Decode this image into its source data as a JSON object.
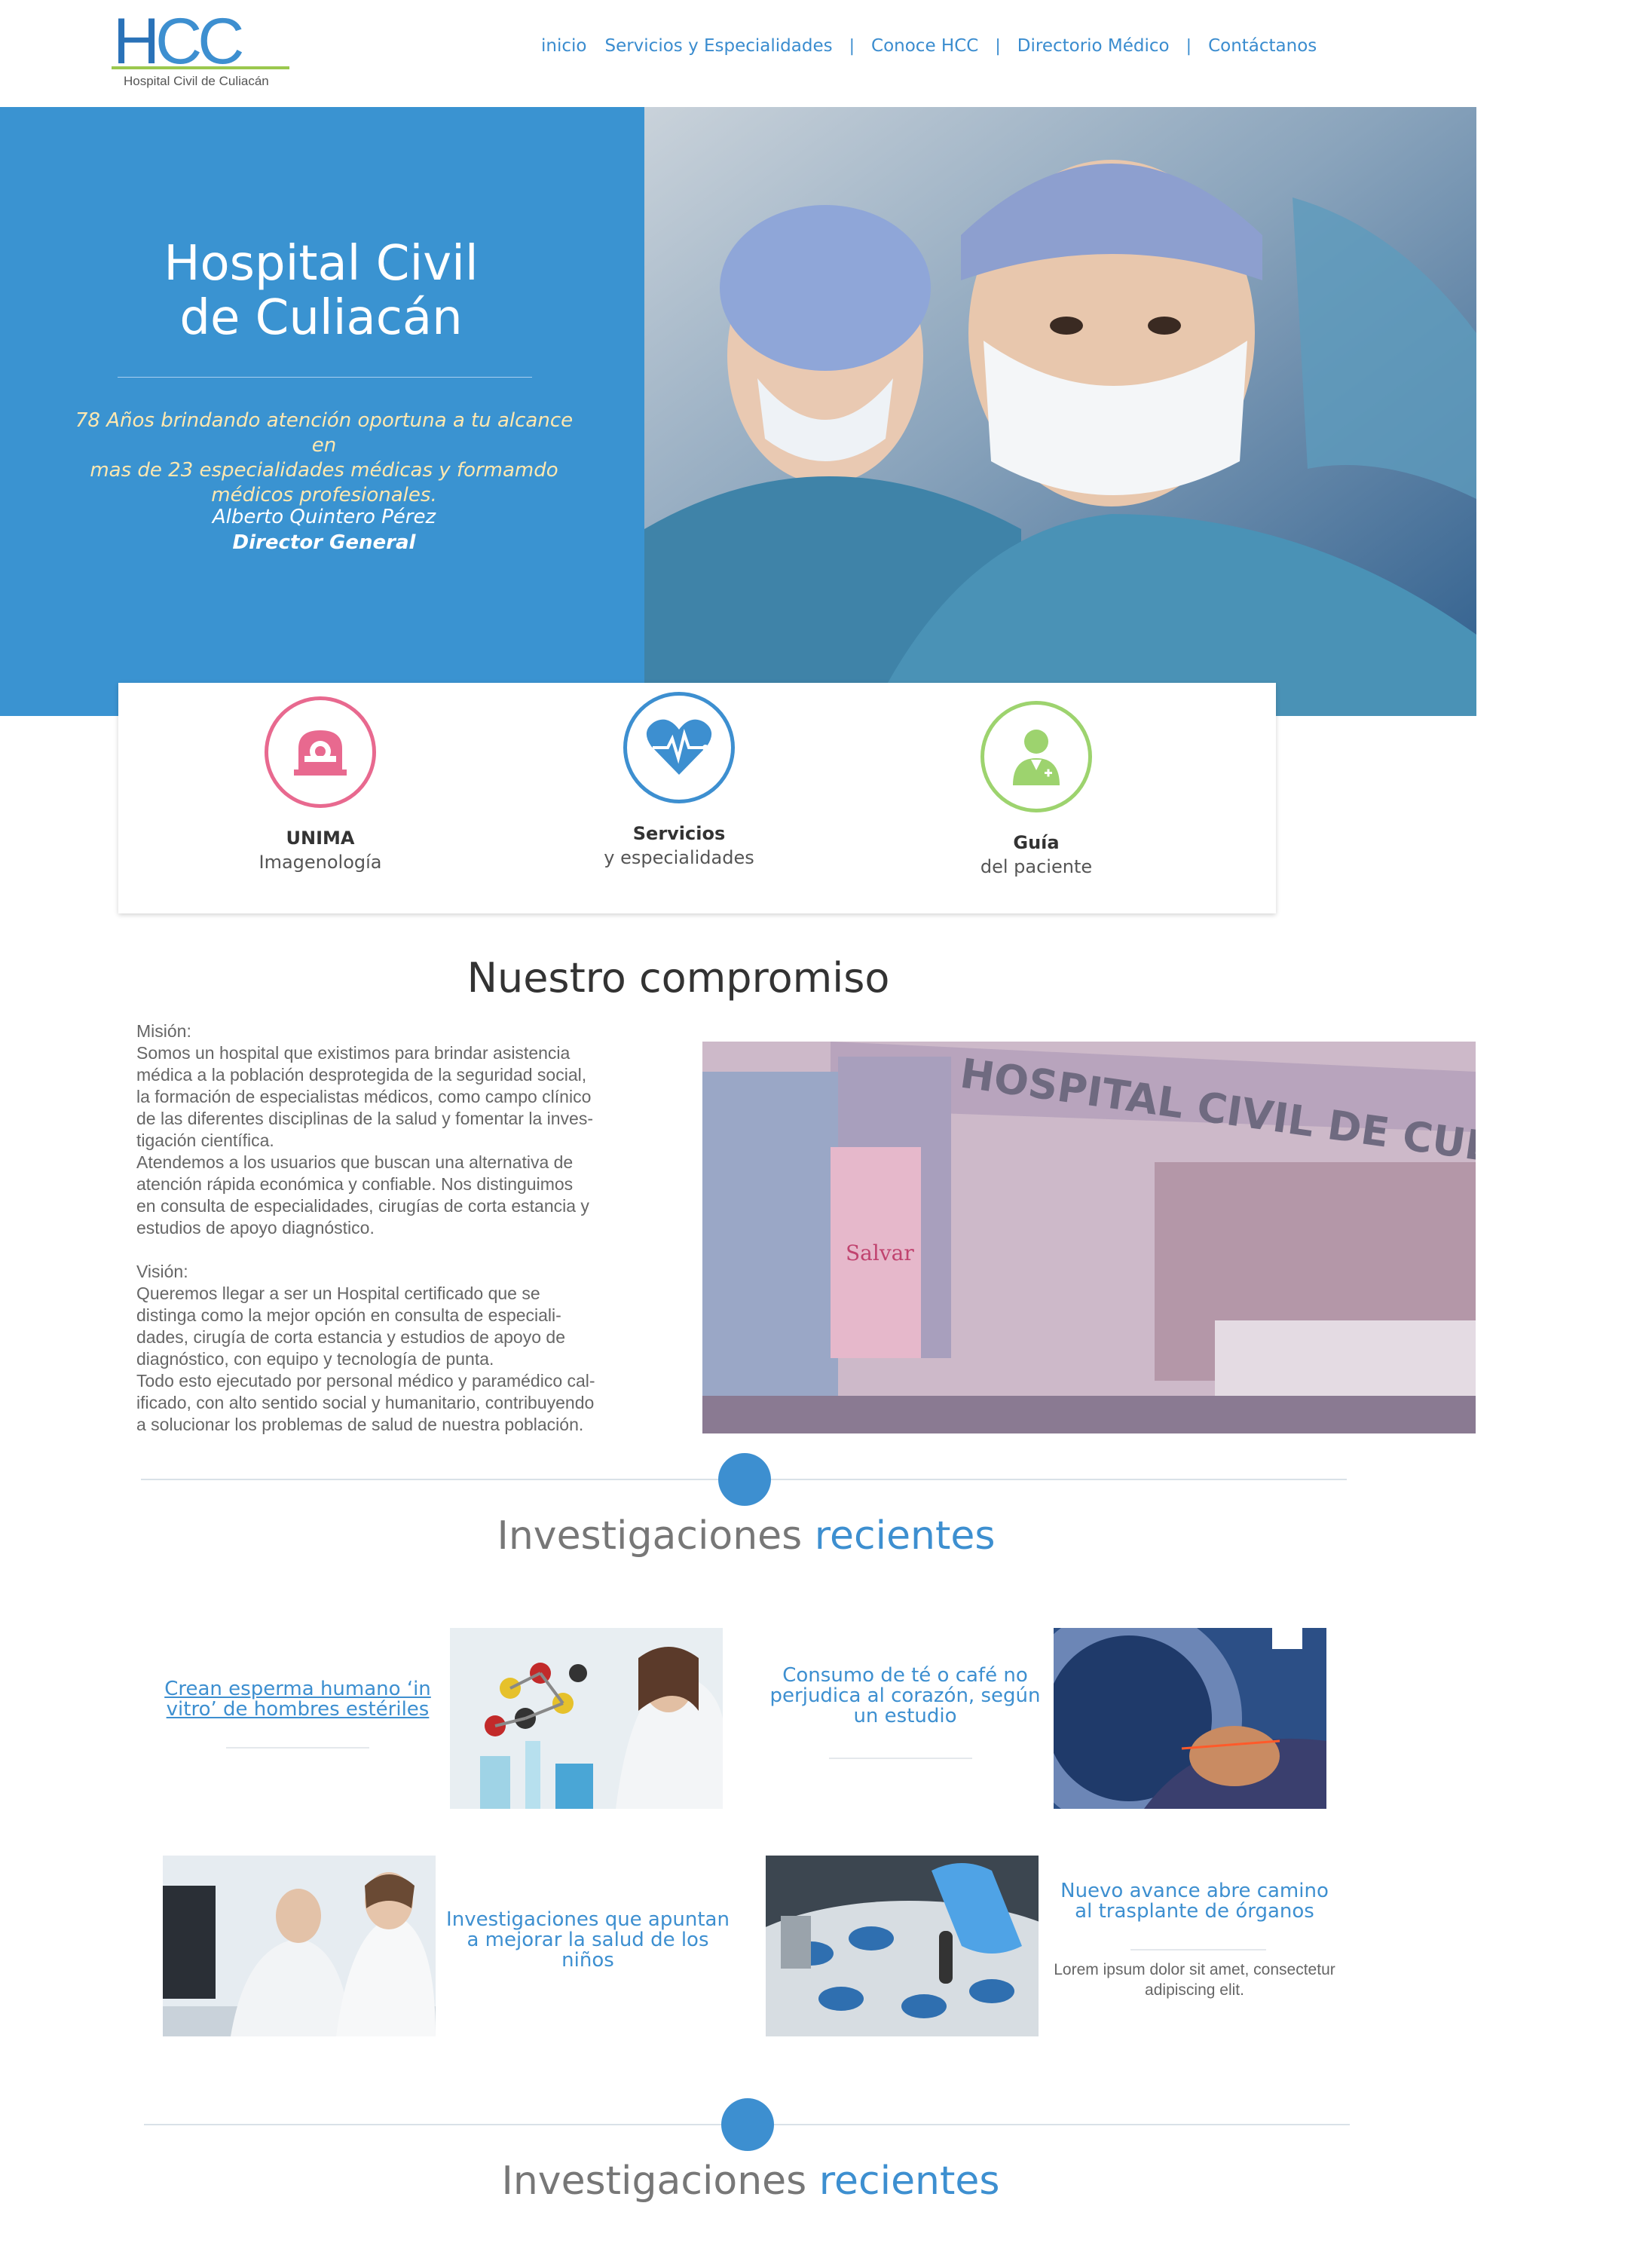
{
  "header": {
    "logo": {
      "letters": [
        "H",
        "C",
        "C"
      ],
      "subtitle": "Hospital Civil de Culiacán"
    },
    "nav": [
      "inicio",
      "Servicios y Especialidades",
      "Conoce HCC",
      "Directorio Médico",
      "Contáctanos"
    ]
  },
  "hero": {
    "title_line1": "Hospital Civil",
    "title_line2": "de Culiacán",
    "tagline_line1": "78 Años brindando atención oportuna a tu alcance en",
    "tagline_line2": "mas de 23 especialidades médicas y formamdo",
    "tagline_line3": "médicos profesionales.",
    "name": "Alberto Quintero Pérez",
    "role": "Director General"
  },
  "quick_links": [
    {
      "title": "UNIMA",
      "subtitle": "Imagenología",
      "icon": "mri-scanner-icon",
      "color": "#e8698f"
    },
    {
      "title": "Servicios",
      "subtitle": "y especialidades",
      "icon": "heart-pulse-icon",
      "color": "#3d8fd0"
    },
    {
      "title": "Guía",
      "subtitle": "del paciente",
      "icon": "doctor-icon",
      "color": "#9dd36e"
    }
  ],
  "commitment": {
    "title": "Nuestro compromiso",
    "mission_label": "Misión:",
    "mission_text": "Somos un hospital que existimos para brindar asistencia\nmédica a la población desprotegida de la seguridad social,\nla formación de especialistas médicos, como campo clínico\nde las diferentes disciplinas de la salud y fomentar la inves-\ntigación científica.\nAtendemos a los usuarios que buscan una alternativa de\natención rápida económica y confiable. Nos distinguimos\nen consulta de especialidades, cirugías de corta estancia y\nestudios de apoyo diagnóstico.",
    "vision_label": "Visión:",
    "vision_text": "Queremos llegar a ser un Hospital certificado que se\ndistinga como la mejor opción en consulta de especiali-\ndades, cirugía de corta estancia y estudios de apoyo de\ndiagnóstico, con equipo y tecnología de punta.\nTodo esto ejecutado por personal médico y paramédico cal-\nificado, con alto sentido social y humanitario, contribuyendo\na solucionar los problemas de salud de nuestra población.",
    "building_sign": "HOSPITAL CIVIL DE CULIACAN",
    "banner_text": "Salvar"
  },
  "investigations": {
    "title_a": "Investigaciones",
    "title_b": "recientes",
    "posts": [
      {
        "title": "Crean esperma humano ‘in vitro’ de hombres estériles"
      },
      {
        "title": "Consumo de té o café no perjudica al corazón, según un estudio"
      },
      {
        "title": "Investigaciones que apuntan a mejorar la salud de los niños"
      },
      {
        "title": "Nuevo avance abre camino al trasplante de órganos",
        "body": "Lorem ipsum dolor sit amet, consectetur adipiscing elit."
      }
    ]
  },
  "colors": {
    "brand_blue": "#3a93d1",
    "accent_blue": "#3d8fd0",
    "pink": "#e8698f",
    "green": "#9dd36e"
  }
}
